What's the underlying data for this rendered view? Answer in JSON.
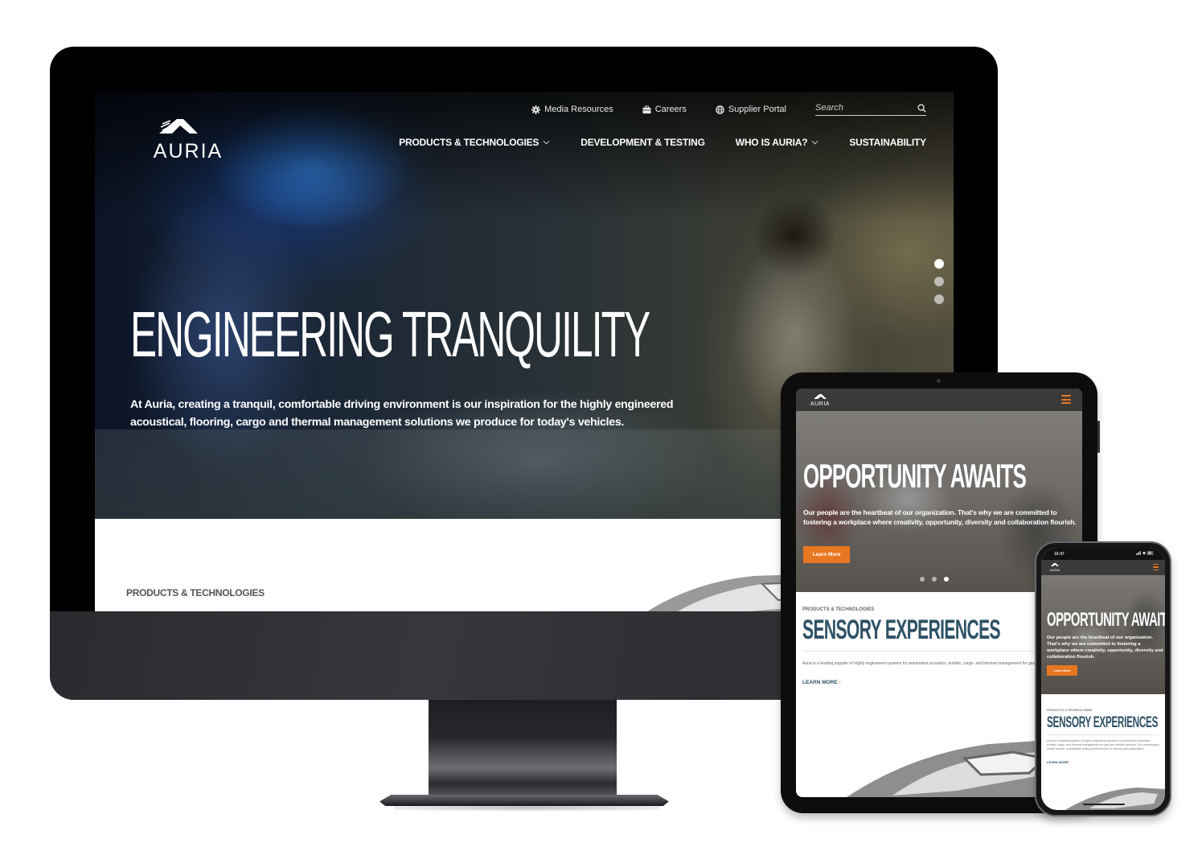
{
  "desktop": {
    "logo_text": "AURIA",
    "utility_nav": [
      {
        "label": "Media Resources",
        "icon": "gear-icon"
      },
      {
        "label": "Careers",
        "icon": "briefcase-icon"
      },
      {
        "label": "Supplier Portal",
        "icon": "globe-icon"
      }
    ],
    "search": {
      "placeholder": "Search",
      "value": ""
    },
    "main_nav": [
      {
        "label": "PRODUCTS & TECHNOLOGIES",
        "has_dropdown": true
      },
      {
        "label": "DEVELOPMENT & TESTING",
        "has_dropdown": false
      },
      {
        "label": "WHO IS AURIA?",
        "has_dropdown": true
      },
      {
        "label": "SUSTAINABILITY",
        "has_dropdown": false
      }
    ],
    "hero": {
      "title": "ENGINEERING TRANQUILITY",
      "description": "At Auria, creating a tranquil, comfortable driving environment is our inspiration for the highly engineered acoustical, flooring, cargo and thermal management solutions we produce for today's vehicles.",
      "slides_total": 3,
      "active_slide": 1
    },
    "section_label": "PRODUCTS & TECHNOLOGIES"
  },
  "tablet": {
    "logo_text": "AURIA",
    "hero": {
      "title": "OPPORTUNITY AWAITS",
      "description": "Our people are the heartbeat of our organization. That's why we are committed to fostering a workplace where creativity, opportunity, diversity and collaboration flourish.",
      "button_label": "Learn More",
      "slides_total": 3,
      "active_slide": 3
    },
    "section_label": "PRODUCTS & TECHNOLOGIES",
    "section_heading": "SENSORY EXPERIENCES",
    "section_body": "Auria is a leading supplier of highly engineered systems for automotive acoustics, textiles, cargo- and thermal management for gas and electric vehicles. Our technologies create serene, comfortable driving environments for drivers and passengers.",
    "learn_more": "LEARN MORE",
    "learn_more_arrow": "›"
  },
  "phone": {
    "status_time": "16:47",
    "logo_text": "AURIA",
    "hero": {
      "title": "OPPORTUNITY AWAITS",
      "description": "Our people are the heartbeat of our organization. That's why we are committed to fostering a workplace where creativity, opportunity, diversity and collaboration flourish.",
      "button_label": "Learn More"
    },
    "section_label": "PRODUCTS & TECHNOLOGIES",
    "section_heading": "SENSORY EXPERIENCES",
    "section_body": "Auria is a leading supplier of highly engineered systems for automotive acoustics, textiles, cargo- and thermal management for gas and electric vehicles. Our technologies create serene, comfortable driving environments for drivers and passengers.",
    "learn_more": "LEARN MORE",
    "learn_more_arrow": "›"
  },
  "colors": {
    "accent_orange": "#e87722",
    "heading_blue": "#2e5266",
    "mobile_header": "#3b3a38"
  }
}
